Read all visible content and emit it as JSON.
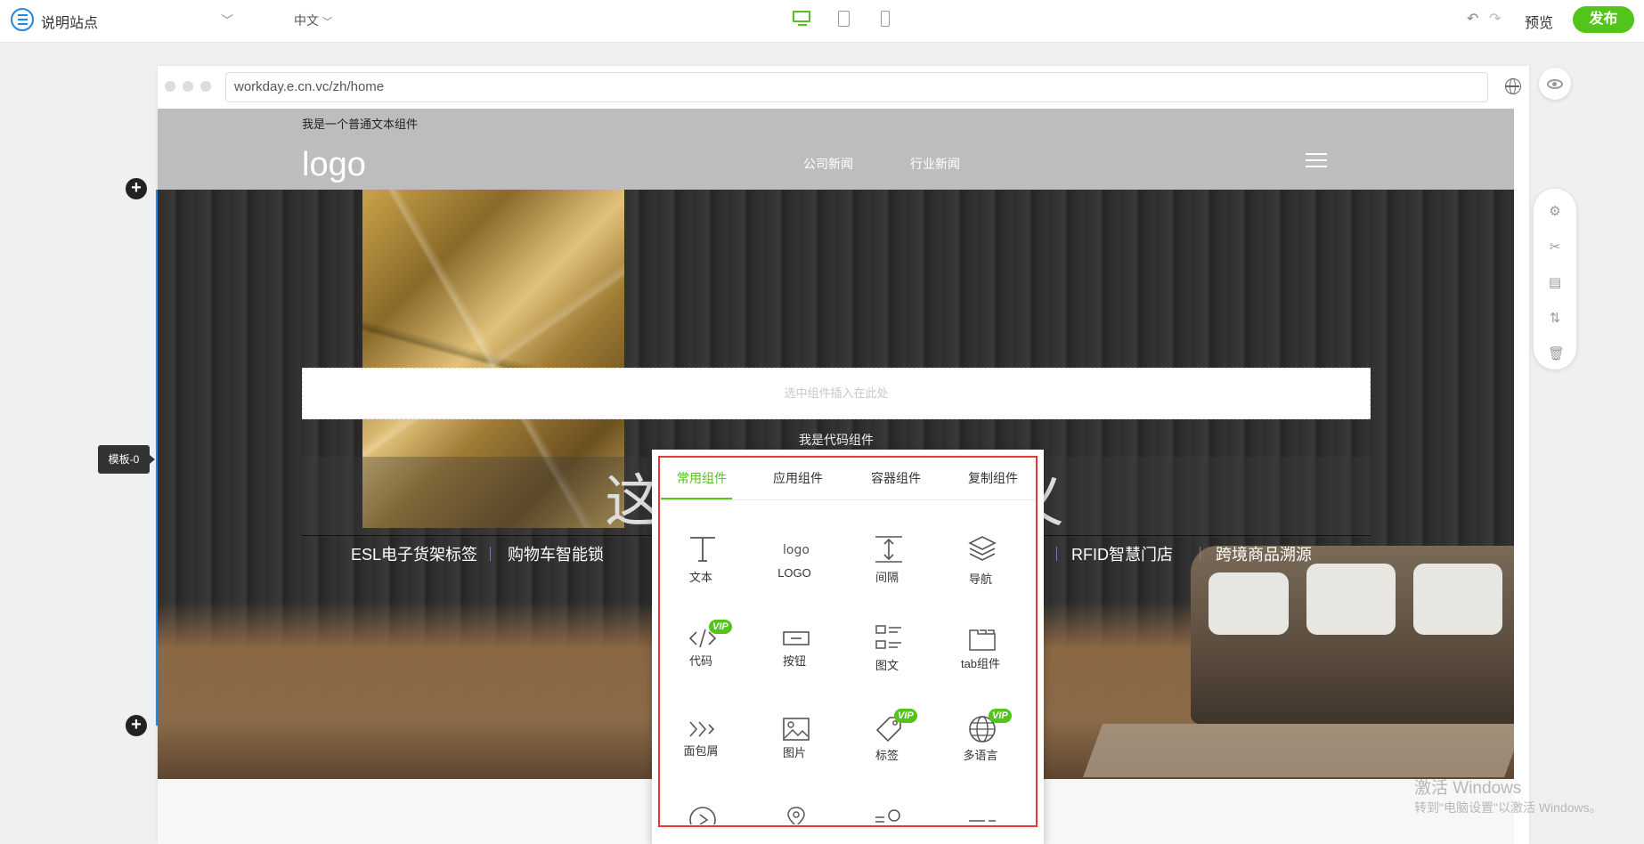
{
  "topbar": {
    "site_name": "说明站点",
    "lang": "中文",
    "preview": "预览",
    "publish": "发布"
  },
  "browser": {
    "url": "workday.e.cn.vc/zh/home"
  },
  "page": {
    "top_text": "我是一个普通文本组件",
    "logo": "logo",
    "nav": [
      "公司新闻",
      "行业新闻"
    ],
    "insert_placeholder": "选中组件插入在此处",
    "code_component": "我是代码组件",
    "headline": "这里是 可 自定义",
    "tags": [
      "ESL电子货架标签",
      "购物车智能锁",
      "RFID智慧门店",
      "跨境商品溯源"
    ]
  },
  "template_label": "模板-0",
  "popup": {
    "tabs": [
      "常用组件",
      "应用组件",
      "容器组件",
      "复制组件"
    ],
    "components": [
      {
        "label": "文本",
        "icon": "text-icon",
        "vip": false
      },
      {
        "label": "LOGO",
        "icon": "logo-icon",
        "vip": false
      },
      {
        "label": "间隔",
        "icon": "spacing-icon",
        "vip": false
      },
      {
        "label": "导航",
        "icon": "layers-icon",
        "vip": false
      },
      {
        "label": "代码",
        "icon": "code-icon",
        "vip": true
      },
      {
        "label": "按钮",
        "icon": "button-icon",
        "vip": false
      },
      {
        "label": "图文",
        "icon": "image-text-icon",
        "vip": false
      },
      {
        "label": "tab组件",
        "icon": "tab-icon",
        "vip": false
      },
      {
        "label": "面包屑",
        "icon": "breadcrumb-icon",
        "vip": false
      },
      {
        "label": "图片",
        "icon": "image-icon",
        "vip": false
      },
      {
        "label": "标签",
        "icon": "tag-icon",
        "vip": true
      },
      {
        "label": "多语言",
        "icon": "globe-icon",
        "vip": true
      }
    ],
    "vip_label": "VIP"
  },
  "watermark": {
    "line1": "激活 Windows",
    "line2": "转到\"电脑设置\"以激活 Windows。"
  },
  "colors": {
    "accent": "#52c41a",
    "highlight": "#e53935",
    "link": "#1e88e5"
  }
}
